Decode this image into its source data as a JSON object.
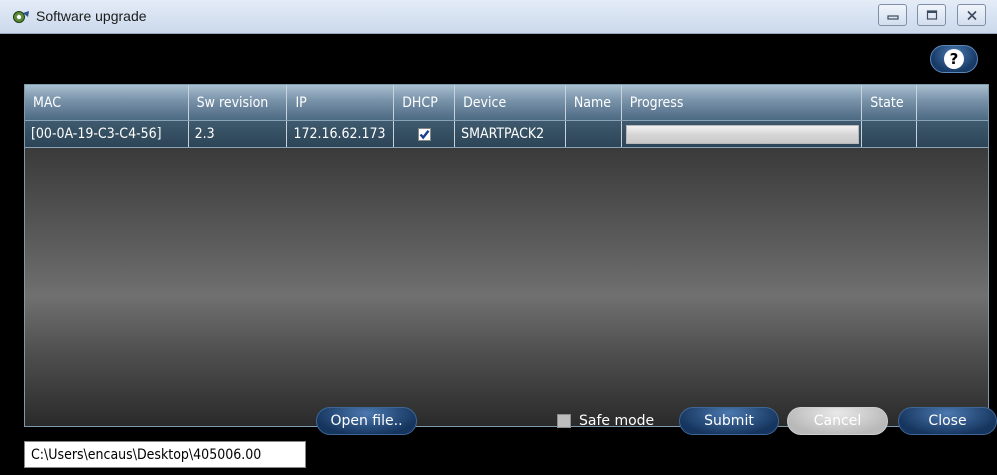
{
  "window": {
    "title": "Software upgrade",
    "icon": "eye-app-icon",
    "controls": [
      "minimize-icon",
      "maximize-icon",
      "close-icon"
    ]
  },
  "help_icon": "question-mark-icon",
  "table": {
    "columns": [
      "MAC",
      "Sw revision",
      "IP",
      "DHCP",
      "Device",
      "Name",
      "Progress",
      "State",
      ""
    ],
    "rows": [
      {
        "mac": "[00-0A-19-C3-C4-56]",
        "sw_revision": "2.3",
        "ip": "172.16.62.173",
        "dhcp_checked": true,
        "device": "SMARTPACK2",
        "name": "",
        "progress_percent": 0,
        "state": ""
      }
    ]
  },
  "file_path": {
    "value": "C:\\Users\\encaus\\Desktop\\405006.00"
  },
  "buttons": {
    "open_file": "Open file..",
    "submit": "Submit",
    "cancel": "Cancel",
    "close": "Close"
  },
  "safe_mode": {
    "label": "Safe mode",
    "checked": false
  },
  "colors": {
    "accent_blue": "#1d3f6b",
    "header_blue": "#7791a8",
    "row_blue": "#36505f",
    "disabled_gray": "#c4c4c4"
  }
}
